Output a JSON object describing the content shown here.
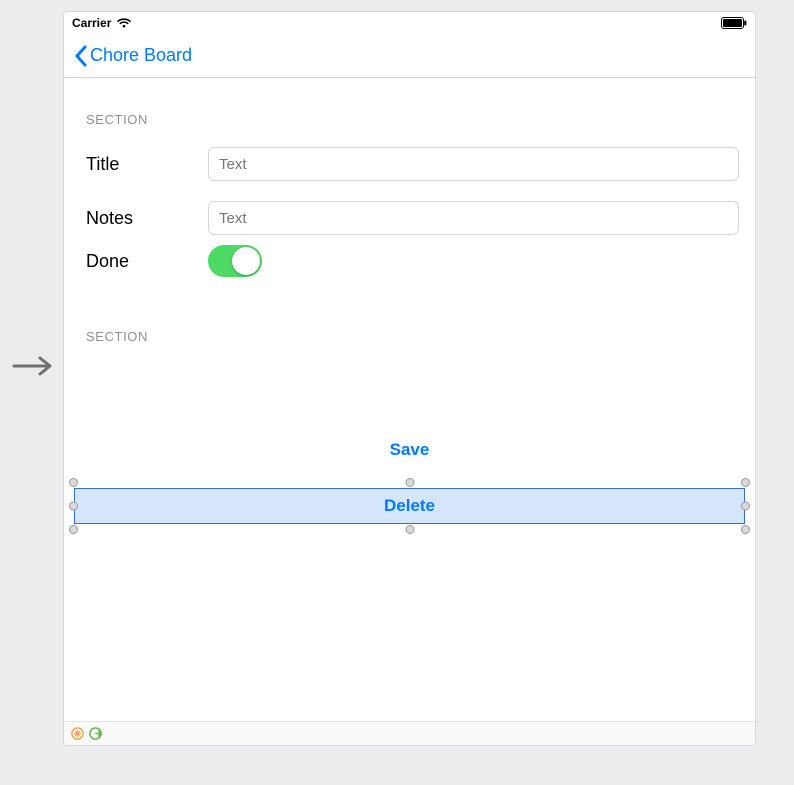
{
  "status_bar": {
    "carrier": "Carrier"
  },
  "nav": {
    "back_label": "Chore Board"
  },
  "sections": {
    "header_1": "SECTION",
    "header_2": "SECTION"
  },
  "form": {
    "title_label": "Title",
    "title_placeholder": "Text",
    "notes_label": "Notes",
    "notes_placeholder": "Text",
    "done_label": "Done",
    "done_value": true
  },
  "buttons": {
    "save": "Save",
    "delete": "Delete"
  },
  "colors": {
    "tint": "#007aff",
    "switch_on": "#4cd964",
    "selection_fill": "#d5e5fb",
    "selection_border": "#2f6fd6"
  }
}
